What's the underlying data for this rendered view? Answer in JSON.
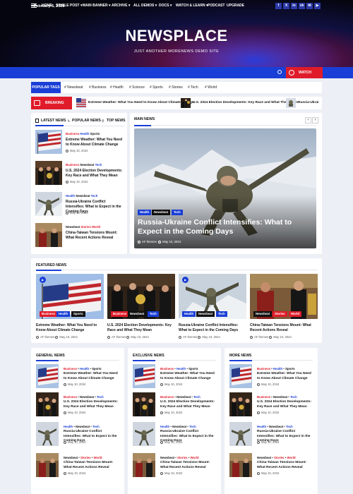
{
  "header": {
    "date": "February 5, 2025",
    "site_title": "NEWSPLACE",
    "tagline": "JUST ANOTHER MORENEWS DEMO SITE",
    "social": [
      "f",
      "X",
      "in",
      "vk",
      "✉",
      "▶"
    ]
  },
  "nav": {
    "items": [
      "HOME",
      "SINGLE POST ▾",
      "MAIN BANNER ▾",
      "ARCHIVE ▾",
      "ALL DEMOS ▾",
      "DOCS ▾",
      "WATCH & LEARN ▾",
      "PODCAST",
      "UPGRADE"
    ],
    "watch_video": "WATCH VIDEO"
  },
  "tags": {
    "label": "POPULAR TAGS",
    "items": [
      "# Newsbeat",
      "# Business",
      "# Health",
      "# Science",
      "# Sports",
      "# Stories",
      "# Tech",
      "# World"
    ]
  },
  "breaking": {
    "label": "BREAKING NEWS",
    "items": [
      "Extreme Weather: What You Need to Know About Climate Change",
      "U.S. 2024 Election Developments: Key Race and What They Mean",
      "Russia-Ukrai"
    ]
  },
  "tabs": {
    "items": [
      "LATEST NEWS",
      "POPULAR NEWS",
      "TOP NEWS"
    ],
    "posts": [
      {
        "cats": [
          "Business",
          "Health",
          "Sports"
        ],
        "title": "Extreme Weather: What You Need to Know About Climate Change",
        "date": "May 10, 2024"
      },
      {
        "cats": [
          "Business",
          "Newsbeat",
          "Tech"
        ],
        "title": "U.S. 2024 Election Developments: Key Race and What They Mean",
        "date": "May 10, 2024"
      },
      {
        "cats": [
          "Health",
          "Newsbeat",
          "Tech"
        ],
        "title": "Russia-Ukraine Conflict Intensifies: What to Expect in the Coming Days",
        "date": "May 10, 2024"
      },
      {
        "cats": [
          "Newsbeat",
          "Stories",
          "World"
        ],
        "title": "China-Taiwan Tensions Mount: What Recent Actions Reveal",
        "date": "May 10, 2024"
      }
    ]
  },
  "main": {
    "label": "MAIN NEWS",
    "prev": "‹",
    "next": "›",
    "badges": [
      "Health",
      "Newsbeat",
      "Tech"
    ],
    "title": "Russia-Ukraine Conflict Intensifies: What to Expect in the Coming Days",
    "author": "AF themes",
    "date": "May 10, 2024"
  },
  "featured": {
    "label": "FEATURED NEWS",
    "posts": [
      {
        "badges": [
          "Business",
          "Health",
          "Sports"
        ],
        "title": "Extreme Weather: What You Need to Know About Climate Change",
        "author": "AF themes",
        "date": "May 10, 2024"
      },
      {
        "badges": [
          "Business",
          "Newsbeat",
          "Tech"
        ],
        "title": "U.S. 2024 Election Developments: Key Race and What They Mean",
        "author": "AF themes",
        "date": "May 10, 2024"
      },
      {
        "badges": [
          "Health",
          "Newsbeat",
          "Tech"
        ],
        "title": "Russia-Ukraine Conflict Intensifies: What to Expect in the Coming Days",
        "author": "AF themes",
        "date": "May 10, 2024"
      },
      {
        "badges": [
          "Newsbeat",
          "Stories",
          "World"
        ],
        "title": "China-Taiwan Tensions Mount: What Recent Actions Reveal",
        "author": "AF themes",
        "date": "May 10, 2024"
      }
    ]
  },
  "columns": {
    "labels": [
      "GENERAL NEWS",
      "EXCLUSIVE NEWS",
      "MORE NEWS"
    ],
    "posts": [
      {
        "cats": [
          "Business",
          "Health",
          "Sports"
        ],
        "title": "Extreme Weather: What You Need to Know About Climate Change",
        "date": "May 10, 2024"
      },
      {
        "cats": [
          "Business",
          "Newsbeat",
          "Tech"
        ],
        "title": "U.S. 2024 Election Developments: Key Race and What They Mean",
        "date": "May 10, 2024"
      },
      {
        "cats": [
          "Health",
          "Newsbeat",
          "Tech"
        ],
        "title": "Russia-Ukraine Conflict Intensifies: What to Expect in the Coming Days",
        "date": "May 10, 2024"
      },
      {
        "cats": [
          "Newsbeat",
          "Stories",
          "World"
        ],
        "title": "China-Taiwan Tensions Mount: What Recent Actions Reveal",
        "date": "May 10, 2024"
      }
    ]
  },
  "colors": {
    "accent_blue": "#1a3fd6",
    "accent_red": "#e01c2a",
    "badge_green": "#1f7a3a"
  }
}
